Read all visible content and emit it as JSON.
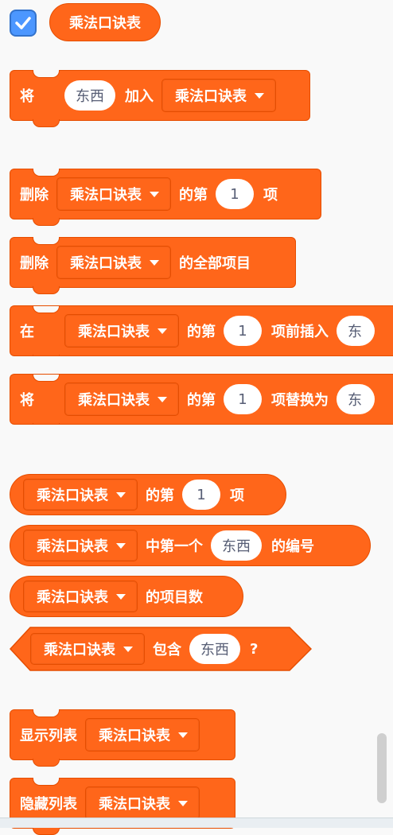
{
  "list_name": "乘法口诀表",
  "blocks": {
    "add": {
      "word1": "将",
      "value": "东西",
      "word2": "加入"
    },
    "delete": {
      "word1": "删除",
      "word2": "的第",
      "index": "1",
      "word3": "项"
    },
    "delete_all": {
      "word1": "删除",
      "word2": "的全部项目"
    },
    "insert": {
      "word1": "在",
      "word2": "的第",
      "index": "1",
      "word3": "项前插入",
      "value_partial": "东"
    },
    "replace": {
      "word1": "将",
      "word2": "的第",
      "index": "1",
      "word3": "项替换为",
      "value_partial": "东"
    },
    "item": {
      "word2": "的第",
      "index": "1",
      "word3": "项"
    },
    "item_num": {
      "word2": "中第一个",
      "value": "东西",
      "word3": "的编号"
    },
    "length": {
      "word2": "的项目数"
    },
    "contains": {
      "word2": "包含",
      "value": "东西",
      "q": "?"
    },
    "show": {
      "word1": "显示列表"
    },
    "hide": {
      "word1": "隐藏列表"
    }
  },
  "colors": {
    "list_block": "#ff661a",
    "list_border": "#e64d00",
    "checkbox": "#4c97ff",
    "background": "#f9f9f9"
  }
}
